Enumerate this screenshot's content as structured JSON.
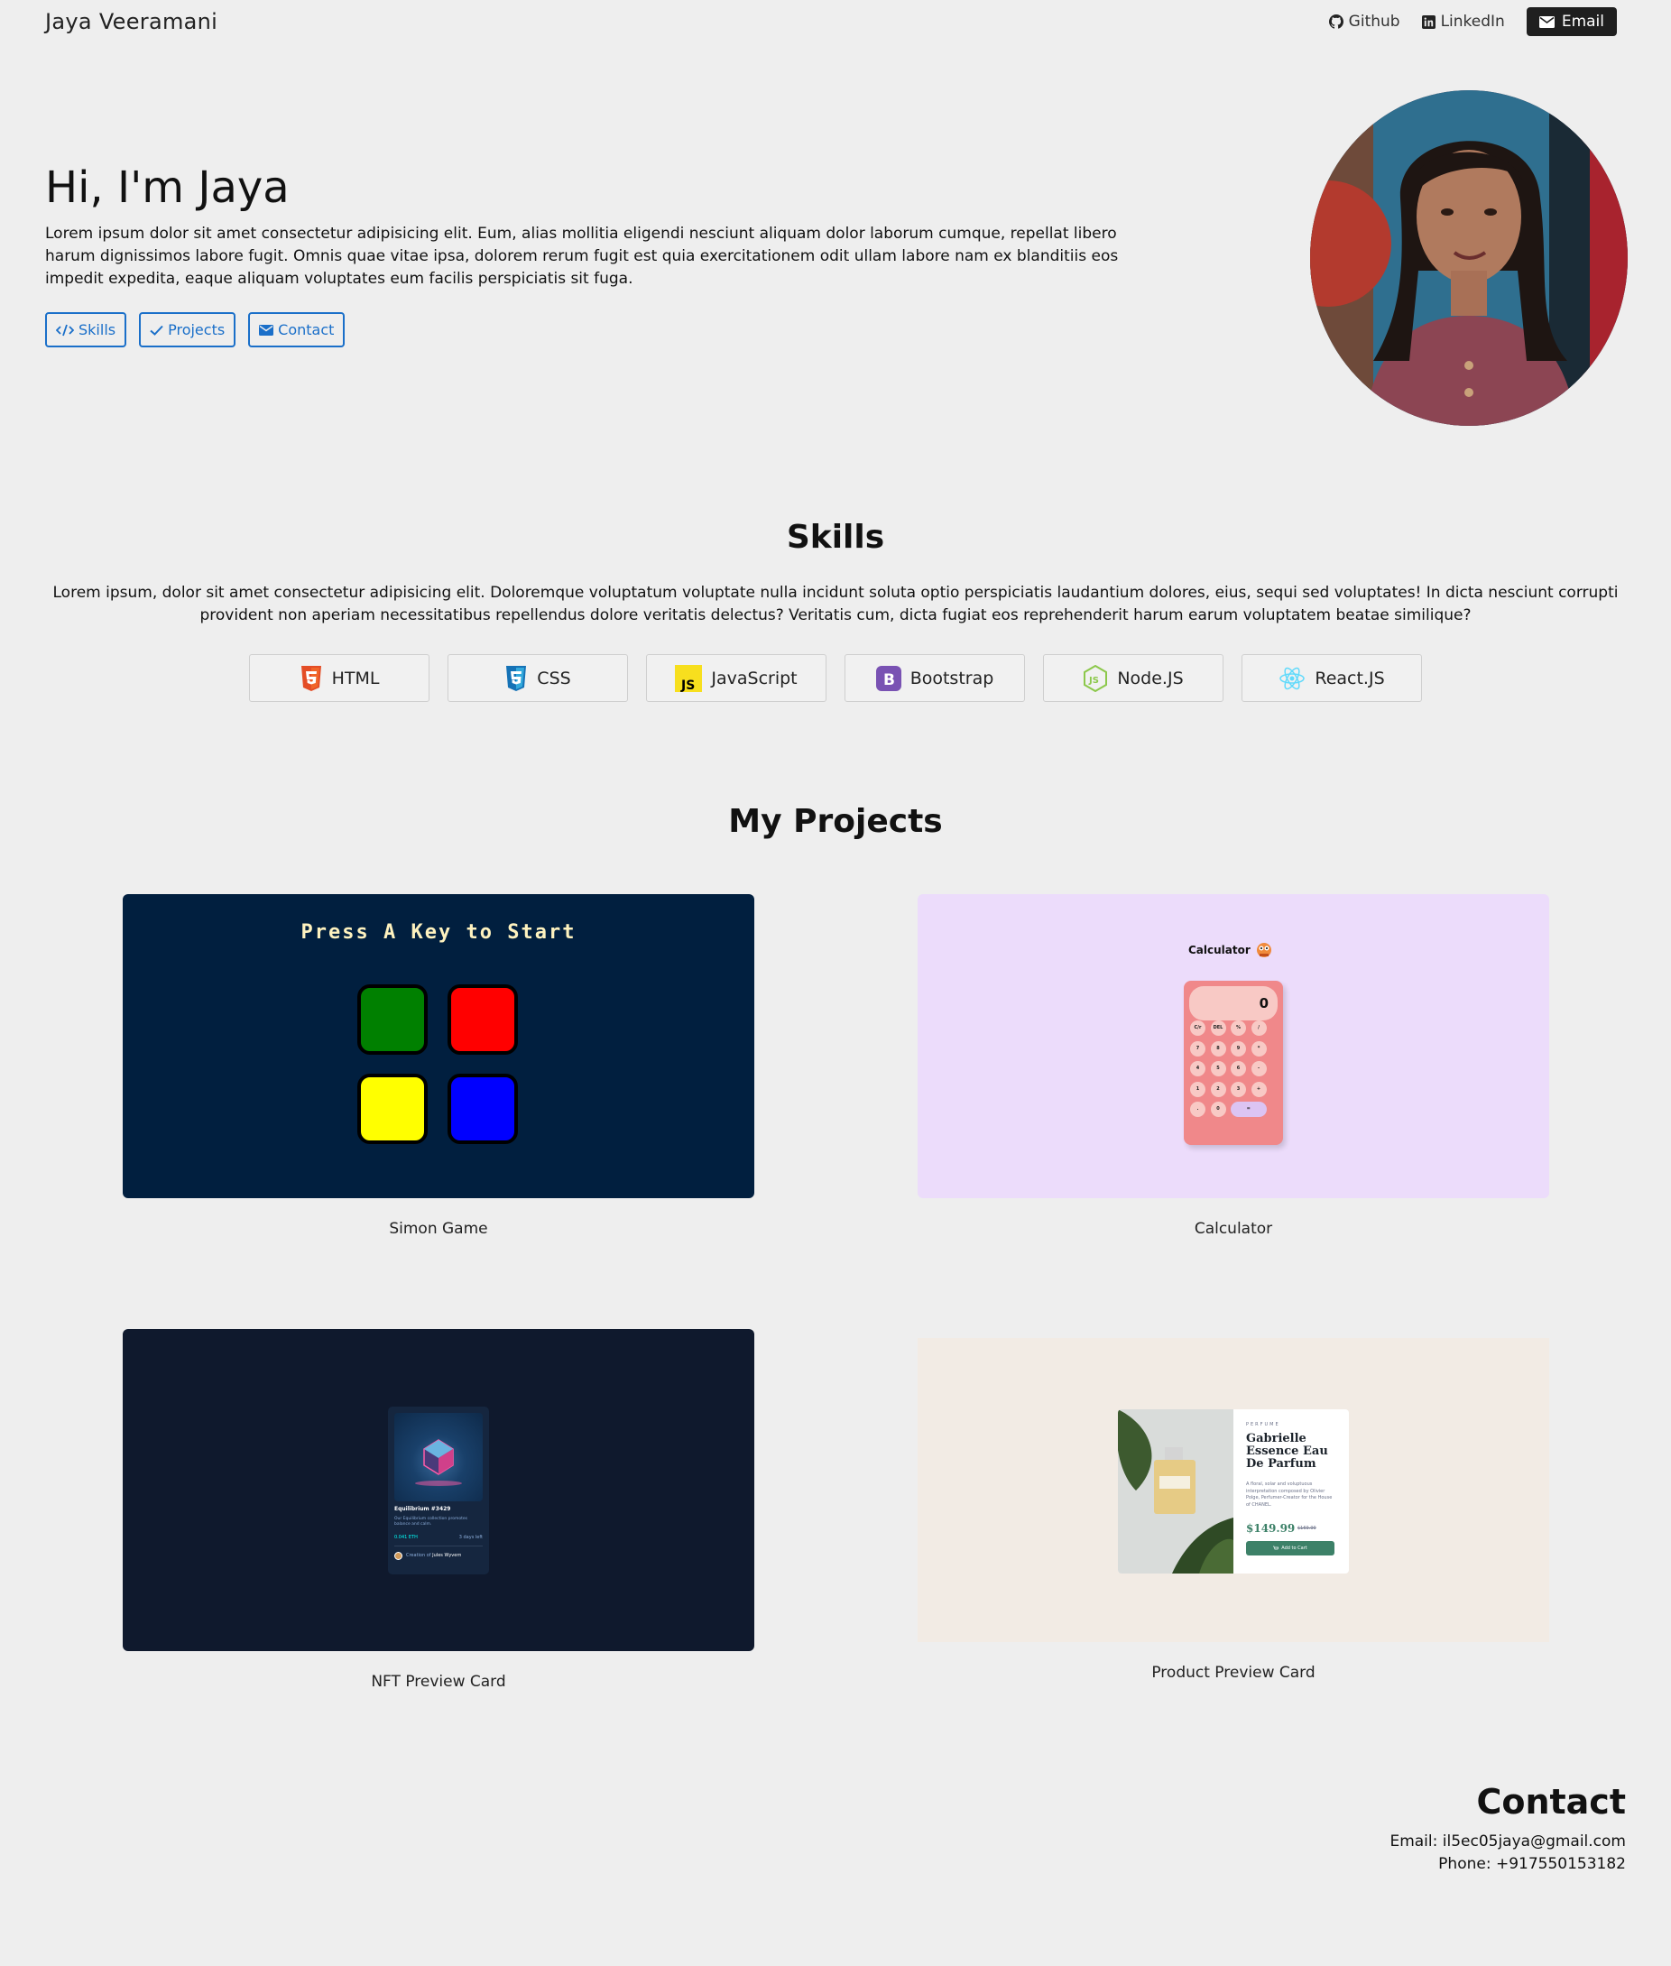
{
  "nav": {
    "brand": "Jaya Veeramani",
    "github": "Github",
    "linkedin": "LinkedIn",
    "email": "Email"
  },
  "hero": {
    "title": "Hi, I'm Jaya",
    "text": "Lorem ipsum dolor sit amet consectetur adipisicing elit. Eum, alias mollitia eligendi nesciunt aliquam dolor laborum cumque, repellat libero harum dignissimos labore fugit. Omnis quae vitae ipsa, dolorem rerum fugit est quia exercitationem odit ullam labore nam ex blanditiis eos impedit expedita, eaque aliquam voluptates eum facilis perspiciatis sit fuga.",
    "buttons": [
      {
        "label": "Skills",
        "icon": "code-icon"
      },
      {
        "label": "Projects",
        "icon": "check-icon"
      },
      {
        "label": "Contact",
        "icon": "envelope-icon"
      }
    ]
  },
  "skills": {
    "title": "Skills",
    "text": "Lorem ipsum, dolor sit amet consectetur adipisicing elit. Doloremque voluptatum voluptate nulla incidunt soluta optio perspiciatis laudantium dolores, eius, sequi sed voluptates! In dicta nesciunt corrupti provident non aperiam necessitatibus repellendus dolore veritatis delectus? Veritatis cum, dicta fugiat eos reprehenderit harum earum voluptatem beatae similique?",
    "items": [
      {
        "label": "HTML",
        "icon": "html5-icon",
        "color": "#e44d26"
      },
      {
        "label": "CSS",
        "icon": "css3-icon",
        "color": "#1572b6"
      },
      {
        "label": "JavaScript",
        "icon": "js-icon",
        "color": "#f7df1e"
      },
      {
        "label": "Bootstrap",
        "icon": "bootstrap-icon",
        "color": "#7952b3"
      },
      {
        "label": "Node.JS",
        "icon": "nodejs-icon",
        "color": "#8cc84b"
      },
      {
        "label": "React.JS",
        "icon": "react-icon",
        "color": "#61dafb"
      }
    ]
  },
  "projects": {
    "title": "My Projects",
    "items": [
      {
        "caption": "Simon Game",
        "preview": {
          "heading": "Press A Key to Start",
          "colors": [
            "#008000",
            "#ff0000",
            "#ffff00",
            "#0000ff"
          ],
          "bg": "#011f3f"
        }
      },
      {
        "caption": "Calculator",
        "preview": {
          "heading": "Calculator",
          "display": "0",
          "keys": [
            "C/r",
            "DEL",
            "%",
            "/",
            "7",
            "8",
            "9",
            "*",
            "4",
            "5",
            "6",
            "-",
            "1",
            "2",
            "3",
            "+",
            ".",
            "0",
            "="
          ],
          "bg": "#ecdcfb"
        }
      },
      {
        "caption": "NFT Preview Card",
        "preview": {
          "title": "Equilibrium #3429",
          "desc": "Our Equilibrium collection promotes balance and calm.",
          "price": "0.041 ETH",
          "time": "3 days left",
          "creator_prefix": "Creation of",
          "creator": "Jules Wyvern",
          "bg": "#0f192d"
        }
      },
      {
        "caption": "Product Preview Card",
        "preview": {
          "category": "PERFUME",
          "name": "Gabrielle Essence Eau De Parfum",
          "desc": "A floral, solar and voluptuous interpretation composed by Olivier Polge, Perfumer-Creator for the House of CHANEL.",
          "price": "$149.99",
          "old_price": "$169.99",
          "button": "Add to Cart",
          "bg": "#f2ebe4"
        }
      }
    ]
  },
  "contact": {
    "title": "Contact",
    "email": "Email: il5ec05jaya@gmail.com",
    "phone": "Phone: +917550153182"
  }
}
